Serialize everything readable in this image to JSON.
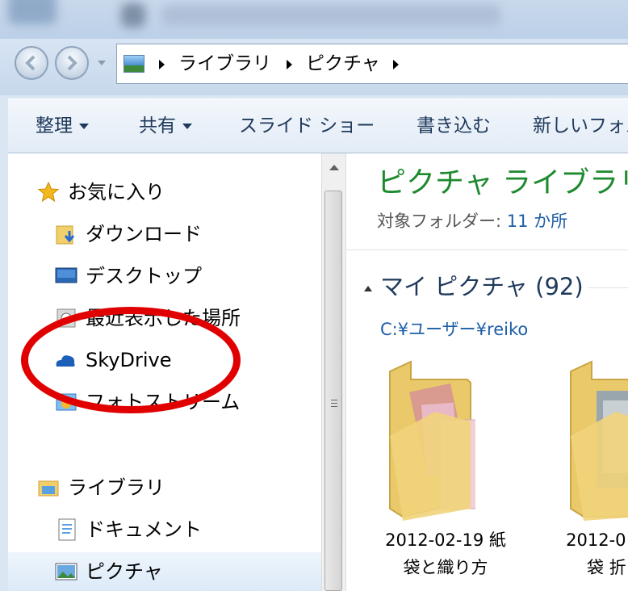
{
  "address_bar": {
    "crumbs": [
      "ライブラリ",
      "ピクチャ"
    ]
  },
  "toolbar": {
    "organize": "整理",
    "share": "共有",
    "slideshow": "スライド ショー",
    "burn": "書き込む",
    "new_folder": "新しいフォル"
  },
  "nav_pane": {
    "favorites_header": "お気に入り",
    "favorites": [
      "ダウンロード",
      "デスクトップ",
      "最近表示した場所",
      "SkyDrive",
      "フォトストリーム"
    ],
    "libraries_header": "ライブラリ",
    "libraries": [
      "ドキュメント",
      "ピクチャ"
    ]
  },
  "content": {
    "library_title": "ピクチャ ライブラリ",
    "includes_label": "対象フォルダー:",
    "includes_link": "11 か所",
    "group_title": "マイ ピクチャ (92)",
    "group_path": "C:¥ユーザー¥reiko",
    "folders": [
      {
        "line1": "2012-02-19 紙",
        "line2": "袋と織り方"
      },
      {
        "line1": "2012-0",
        "line2": "袋 折"
      }
    ]
  },
  "colors": {
    "highlight_circle": "#e00000",
    "library_title": "#1e8a2f",
    "link": "#1c5ea8"
  }
}
